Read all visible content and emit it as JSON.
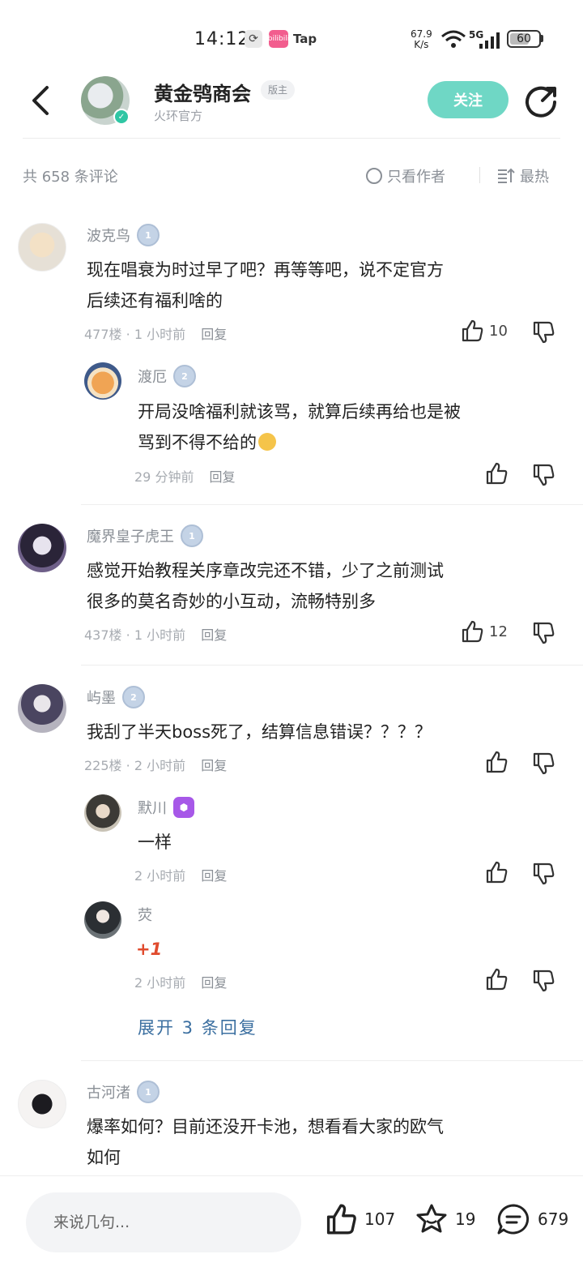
{
  "status": {
    "time": "14:12",
    "bili": "bilibili",
    "tap": "Tap",
    "speed_value": "67.9",
    "speed_unit": "K/s",
    "network": "5G",
    "battery": "60"
  },
  "header": {
    "name": "黄金鸮商会",
    "tag": "版主",
    "subtitle": "火环官方",
    "follow": "关注"
  },
  "bar": {
    "count": "共 658 条评论",
    "author_only": "只看作者",
    "sort": "最热"
  },
  "comments": [
    {
      "user": "波克鸟",
      "level": "1",
      "text_lines": [
        "现在唱衰为时过早了吧？再等等吧，说不定官方",
        "后续还有福利啥的"
      ],
      "floor": "477楼",
      "time": "1 小时前",
      "reply": "回复",
      "likes": "10"
    },
    {
      "user": "渡厄",
      "level": "2",
      "text_lines": [
        "开局没啥福利就该骂，就算后续再给也是被",
        "骂到不得不给的"
      ],
      "time": "29 分钟前",
      "reply": "回复"
    },
    {
      "user": "魔界皇子虎王",
      "level": "1",
      "text_lines": [
        "感觉开始教程关序章改完还不错，少了之前测试",
        "很多的莫名奇妙的小互动，流畅特别多"
      ],
      "floor": "437楼",
      "time": "1 小时前",
      "reply": "回复",
      "likes": "12"
    },
    {
      "user": "屿墨",
      "level": "2",
      "text_lines": [
        "我刮了半天boss死了，结算信息错误？？？？"
      ],
      "floor": "225楼",
      "time": "2 小时前",
      "reply": "回复"
    },
    {
      "user": "默川",
      "text_lines": [
        "一样"
      ],
      "time": "2 小时前",
      "reply": "回复"
    },
    {
      "user": "荧",
      "text_lines": [
        "+1"
      ],
      "time": "2 小时前",
      "reply": "回复"
    },
    {
      "user": "古河渚",
      "level": "1",
      "text_lines": [
        "爆率如何？目前还没开卡池，想看看大家的欧气",
        "如何"
      ]
    }
  ],
  "expand": "展开 3 条回复",
  "bottom": {
    "placeholder": "来说几句...",
    "likes": "107",
    "favorites": "19",
    "comments": "679"
  },
  "colors": {
    "accent": "#6fd7c5",
    "link": "#3b6fa0",
    "meta": "#a7abb1"
  }
}
